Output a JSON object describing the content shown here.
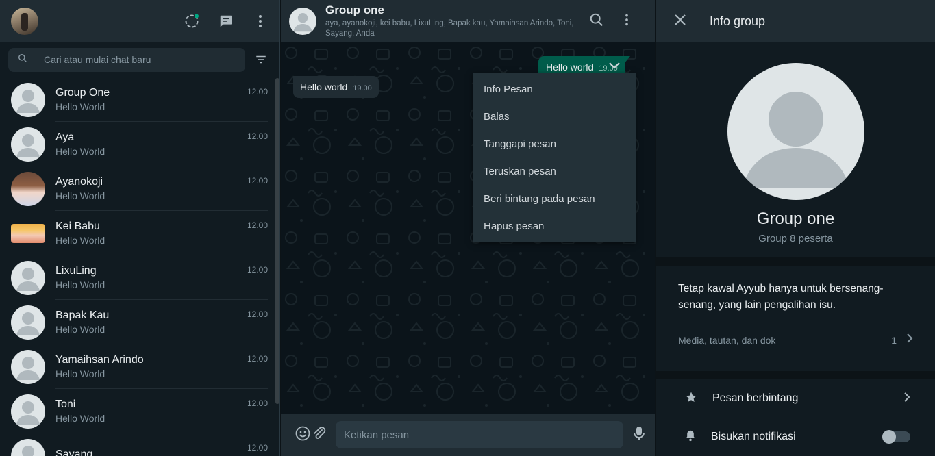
{
  "left": {
    "search_placeholder": "Cari atau mulai chat baru",
    "chats": [
      {
        "name": "Group One",
        "message": "Hello World",
        "time": "12.00",
        "avatar": "default"
      },
      {
        "name": "Aya",
        "message": "Hello World",
        "time": "12.00",
        "avatar": "default"
      },
      {
        "name": "Ayanokoji",
        "message": "Hello World",
        "time": "12.00",
        "avatar": "photo"
      },
      {
        "name": "Kei Babu",
        "message": "Hello World",
        "time": "12.00",
        "avatar": "photo"
      },
      {
        "name": "LixuLing",
        "message": "Hello World",
        "time": "12.00",
        "avatar": "default"
      },
      {
        "name": "Bapak Kau",
        "message": "Hello World",
        "time": "12.00",
        "avatar": "default"
      },
      {
        "name": "Yamaihsan Arindo",
        "message": "Hello World",
        "time": "12.00",
        "avatar": "default"
      },
      {
        "name": "Toni",
        "message": "Hello World",
        "time": "12.00",
        "avatar": "default"
      },
      {
        "name": "Sayang",
        "message": "",
        "time": "12.00",
        "avatar": "default"
      }
    ]
  },
  "conversation": {
    "title": "Group one",
    "members": "aya, ayanokoji, kei babu, LixuLing, Bapak kau, Yamaihsan Arindo, Toni, Sayang, Anda",
    "incoming": {
      "text": "Hello world",
      "time": "19.00"
    },
    "outgoing": {
      "text": "Hello world",
      "time": "19.00"
    },
    "context_menu": [
      "Info Pesan",
      "Balas",
      "Tanggapi pesan",
      "Teruskan pesan",
      "Beri bintang pada pesan",
      "Hapus pesan"
    ],
    "composer_placeholder": "Ketikan pesan"
  },
  "info": {
    "header_title": "Info group",
    "group_name": "Group one",
    "group_count": "Group 8 peserta",
    "description": "Tetap kawal Ayyub hanya untuk bersenang-senang, yang lain pengalihan isu.",
    "media_label": "Media, tautan, dan dok",
    "media_count": "1",
    "starred_label": "Pesan berbintang",
    "mute_label": "Bisukan notifikasi",
    "mute_enabled": false
  },
  "colors": {
    "accent": "#00a884",
    "outgoing_bubble": "#005c4b",
    "panel": "#202c33",
    "background": "#111b21"
  }
}
